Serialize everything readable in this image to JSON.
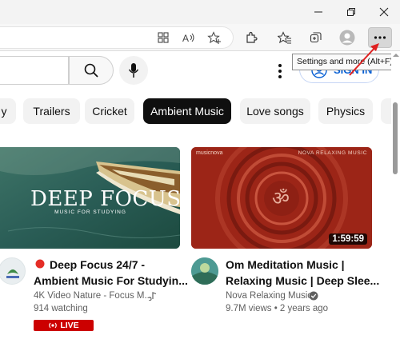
{
  "window": {
    "minimize_icon": "minimize-icon",
    "restore_icon": "restore-icon",
    "close_icon": "close-icon"
  },
  "toolbar": {
    "icons": [
      "split-screen-icon",
      "read-aloud-icon",
      "add-favorite-icon",
      "extensions-icon",
      "favorites-icon",
      "collections-icon",
      "profile-icon",
      "more-icon"
    ],
    "tooltip": "Settings and more (Alt+F)"
  },
  "header": {
    "search_icon": "search-icon",
    "mic_icon": "microphone-icon",
    "signin_label": "SIGN IN"
  },
  "chips": [
    {
      "label": "y",
      "active": false
    },
    {
      "label": "Trailers",
      "active": false
    },
    {
      "label": "Cricket",
      "active": false
    },
    {
      "label": "Ambient Music",
      "active": true
    },
    {
      "label": "Love songs",
      "active": false
    },
    {
      "label": "Physics",
      "active": false
    }
  ],
  "videos": [
    {
      "thumb_title": "DEEP FOCUS",
      "thumb_subtitle": "MUSIC FOR STUDYING",
      "title_line1": "Deep Focus 24/7 -",
      "title_line2": "Ambient Music For Studyin...",
      "channel": "4K Video Nature - Focus M...",
      "stats": "914 watching",
      "badge": "LIVE",
      "live_color": "#cc0000"
    },
    {
      "thumb_brand_left": "musicnova",
      "thumb_brand_right": "NOVA RELAXING MUSIC",
      "duration": "1:59:59",
      "title_line1": "Om Meditation Music |",
      "title_line2": "Relaxing Music | Deep Slee...",
      "channel": "Nova Relaxing Music",
      "stats": "9.7M views • 2 years ago"
    }
  ],
  "colors": {
    "accent_blue": "#065fd4",
    "annotation_arrow": "#e02020"
  }
}
